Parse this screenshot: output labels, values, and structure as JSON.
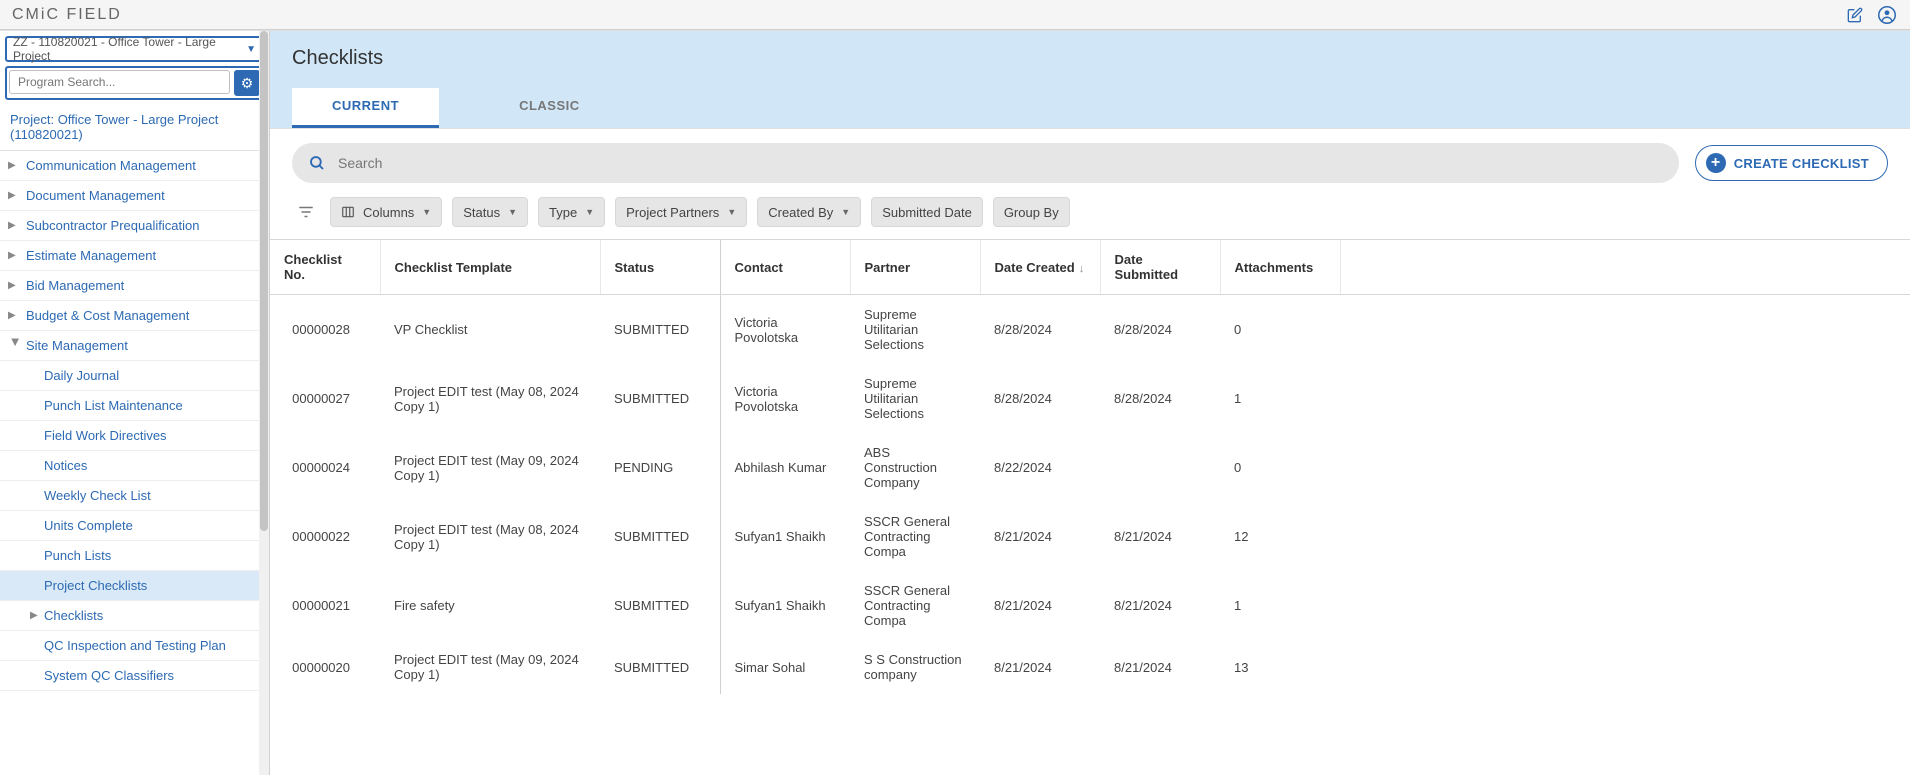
{
  "brand": {
    "part1": "CMiC",
    "part2": "FIELD"
  },
  "project_select": "ZZ - 110820021 - Office Tower - Large Project",
  "program_search_placeholder": "Program Search...",
  "project_label": {
    "prefix": "Project: ",
    "name": "Office Tower - Large Project",
    "code": " (110820021)"
  },
  "nav_top": [
    "Communication Management",
    "Document Management",
    "Subcontractor Prequalification",
    "Estimate Management",
    "Bid Management",
    "Budget & Cost Management"
  ],
  "nav_site_management": "Site Management",
  "nav_site_sub": [
    "Daily Journal",
    "Punch List Maintenance",
    "Field Work Directives",
    "Notices",
    "Weekly Check List",
    "Units Complete",
    "Punch Lists",
    "Project Checklists",
    "Checklists",
    "QC Inspection and Testing Plan",
    "System QC Classifiers"
  ],
  "page_title": "Checklists",
  "tabs": {
    "current": "CURRENT",
    "classic": "CLASSIC"
  },
  "search_placeholder": "Search",
  "create_btn": "CREATE CHECKLIST",
  "filter_chips": {
    "columns": "Columns",
    "status": "Status",
    "type": "Type",
    "project_partners": "Project Partners",
    "created_by": "Created By",
    "submitted_date": "Submitted Date",
    "group_by": "Group By"
  },
  "table_headers": {
    "no": "Checklist No.",
    "template": "Checklist Template",
    "status": "Status",
    "contact": "Contact",
    "partner": "Partner",
    "date_created": "Date Created",
    "date_submitted": "Date Submitted",
    "attachments": "Attachments"
  },
  "rows": [
    {
      "no": "00000028",
      "template": "VP Checklist",
      "status": "SUBMITTED",
      "contact": "Victoria Povolotska",
      "partner": "Supreme Utilitarian Selections",
      "created": "8/28/2024",
      "submitted": "8/28/2024",
      "attachments": "0"
    },
    {
      "no": "00000027",
      "template": "Project EDIT test (May 08, 2024 Copy 1)",
      "status": "SUBMITTED",
      "contact": "Victoria Povolotska",
      "partner": "Supreme Utilitarian Selections",
      "created": "8/28/2024",
      "submitted": "8/28/2024",
      "attachments": "1"
    },
    {
      "no": "00000024",
      "template": "Project EDIT test (May 09, 2024 Copy 1)",
      "status": "PENDING",
      "contact": "Abhilash Kumar",
      "partner": "ABS Construction Company",
      "created": "8/22/2024",
      "submitted": "",
      "attachments": "0"
    },
    {
      "no": "00000022",
      "template": "Project EDIT test (May 08, 2024 Copy 1)",
      "status": "SUBMITTED",
      "contact": "Sufyan1 Shaikh",
      "partner": "SSCR General Contracting Compa",
      "created": "8/21/2024",
      "submitted": "8/21/2024",
      "attachments": "12"
    },
    {
      "no": "00000021",
      "template": "Fire safety",
      "status": "SUBMITTED",
      "contact": "Sufyan1 Shaikh",
      "partner": "SSCR General Contracting Compa",
      "created": "8/21/2024",
      "submitted": "8/21/2024",
      "attachments": "1"
    },
    {
      "no": "00000020",
      "template": "Project EDIT test (May 09, 2024 Copy 1)",
      "status": "SUBMITTED",
      "contact": "Simar Sohal",
      "partner": "S S Construction company",
      "created": "8/21/2024",
      "submitted": "8/21/2024",
      "attachments": "13"
    }
  ]
}
